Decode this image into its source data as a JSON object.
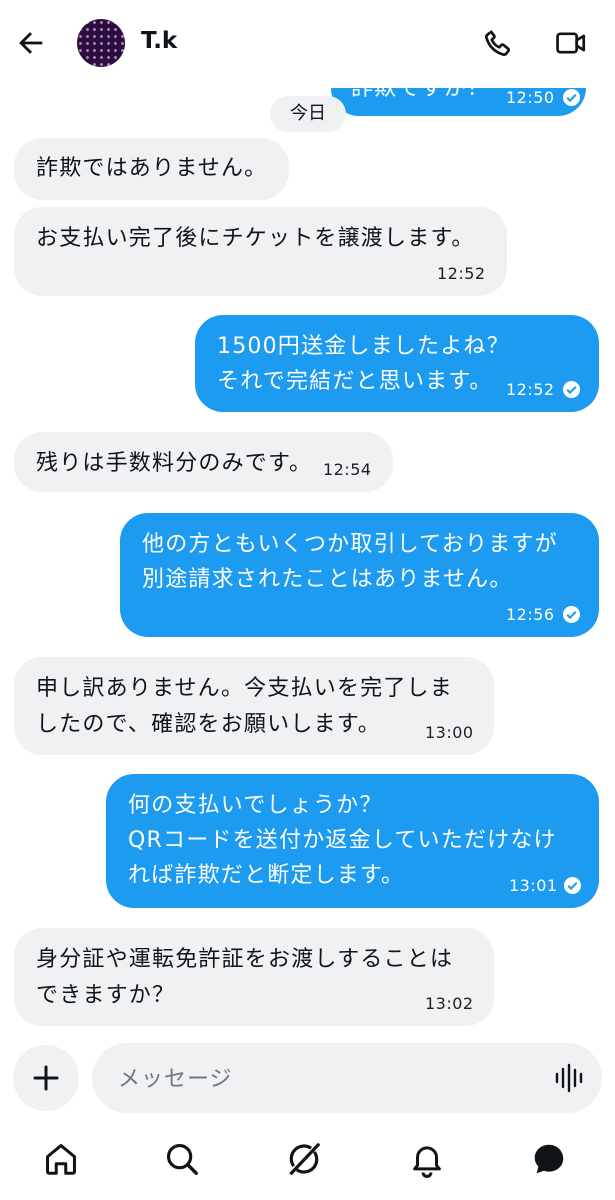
{
  "header": {
    "title": "T.k",
    "back_icon": "arrow-left-icon",
    "call_icon": "phone-icon",
    "video_icon": "video-camera-icon"
  },
  "colors": {
    "outgoing_bubble": "#1d9bf0",
    "incoming_bubble": "#eff1f3",
    "text": "#0f1419"
  },
  "day_separator": "今日",
  "messages": [
    {
      "direction": "out",
      "lines": [
        "詐欺ですか？"
      ],
      "time": "12:50",
      "read": true
    },
    {
      "direction": "in",
      "lines": [
        "詐欺ではありません。"
      ],
      "time": ""
    },
    {
      "direction": "in",
      "lines": [
        "お支払い完了後にチケットを譲渡します。"
      ],
      "time": "12:52"
    },
    {
      "direction": "out",
      "lines": [
        "1500円送金しましたよね？",
        "それで完結だと思います。"
      ],
      "time": "12:52",
      "read": true
    },
    {
      "direction": "in",
      "lines": [
        "残りは手数料分のみです。"
      ],
      "time": "12:54"
    },
    {
      "direction": "out",
      "lines": [
        "他の方ともいくつか取引しておりますが",
        "別途請求されたことはありません。"
      ],
      "time": "12:56",
      "read": true
    },
    {
      "direction": "in",
      "lines": [
        "申し訳ありません。今支払いを完了しま",
        "したので、確認をお願いします。"
      ],
      "time": "13:00"
    },
    {
      "direction": "out",
      "lines": [
        "何の支払いでしょうか？",
        "QRコードを送付か返金していただけなけ",
        "れば詐欺だと断定します。"
      ],
      "time": "13:01",
      "read": true
    },
    {
      "direction": "in",
      "lines": [
        "身分証や運転免許証をお渡しすることは",
        "できますか？"
      ],
      "time": "13:02"
    }
  ],
  "composer": {
    "placeholder": "メッセージ",
    "add_icon": "plus-icon",
    "voice_icon": "voice-waveform-icon"
  },
  "bottom_nav": [
    {
      "name": "home",
      "icon": "home-icon"
    },
    {
      "name": "search",
      "icon": "search-icon"
    },
    {
      "name": "grok",
      "icon": "grok-icon"
    },
    {
      "name": "notifications",
      "icon": "bell-icon"
    },
    {
      "name": "messages",
      "icon": "messages-icon",
      "active": true
    }
  ]
}
